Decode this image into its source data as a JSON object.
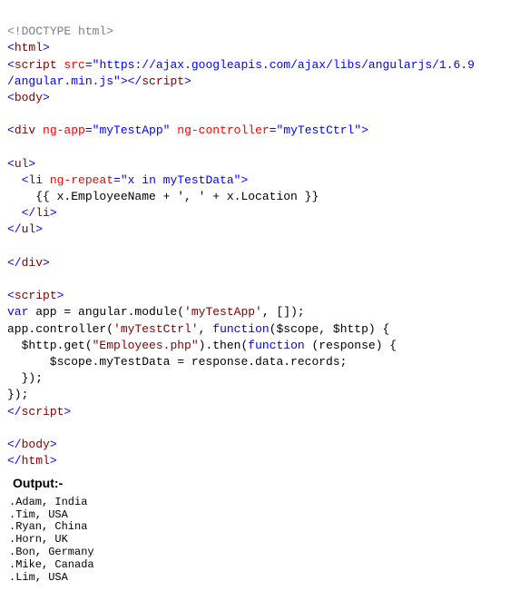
{
  "code": {
    "l1_doctype_open": "<!",
    "l1_doctype_text": "DOCTYPE html",
    "l1_doctype_close": ">",
    "l2": "html",
    "l3_tag": "script",
    "l3_attr": " src",
    "l3_eq": "=",
    "l3_val": "\"https://ajax.googleapis.com/ajax/libs/angularjs/1.6.9\n/angular.min.js\"",
    "l3_close": "></",
    "l3_close2": ">",
    "l5": "body",
    "l7_tag": "div",
    "l7_a1": " ng-app",
    "l7_v1": "\"myTestApp\"",
    "l7_a2": " ng-controller",
    "l7_v2": "\"myTestCtrl\"",
    "l9": "ul",
    "l10_tag": "li",
    "l10_attr": " ng-repeat",
    "l10_val": "\"x in myTestData\"",
    "l11": "    {{ x.EmployeeName + ', ' + x.Location }}",
    "l12": "li",
    "l13": "ul",
    "l15": "div",
    "l17": "script",
    "l18a": "var",
    "l18b": " app = angular.module(",
    "l18c": "'myTestApp'",
    "l18d": ", []);",
    "l19a": "app.controller(",
    "l19b": "'myTestCtrl'",
    "l19c": ", ",
    "l19d": "function",
    "l19e": "($scope, $http) {",
    "l20a": "  $http.get(",
    "l20b": "\"Employees.php\"",
    "l20c": ").then(",
    "l20d": "function",
    "l20e": " (response) {",
    "l21": "      $scope.myTestData = response.data.records;",
    "l22": "  });",
    "l23": "});",
    "l24": "script",
    "l26": "body",
    "l27": "html"
  },
  "output": {
    "header": "Output:-",
    "items": [
      ".Adam, India",
      ".Tim, USA",
      ".Ryan, China",
      ".Horn, UK",
      ".Bon, Germany",
      ".Mike, Canada",
      ".Lim, USA"
    ]
  }
}
